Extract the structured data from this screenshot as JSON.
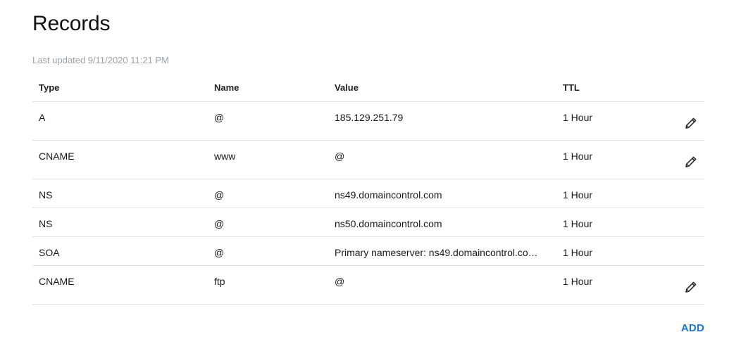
{
  "page": {
    "title": "Records",
    "last_updated": "Last updated 9/11/2020 11:21 PM"
  },
  "table": {
    "headers": {
      "type": "Type",
      "name": "Name",
      "value": "Value",
      "ttl": "TTL"
    },
    "rows": [
      {
        "type": "A",
        "name": "@",
        "value": "185.129.251.79",
        "ttl": "1 Hour",
        "editable": true
      },
      {
        "type": "CNAME",
        "name": "www",
        "value": "@",
        "ttl": "1 Hour",
        "editable": true
      },
      {
        "type": "NS",
        "name": "@",
        "value": "ns49.domaincontrol.com",
        "ttl": "1 Hour",
        "editable": false
      },
      {
        "type": "NS",
        "name": "@",
        "value": "ns50.domaincontrol.com",
        "ttl": "1 Hour",
        "editable": false
      },
      {
        "type": "SOA",
        "name": "@",
        "value": "Primary nameserver: ns49.domaincontrol.co…",
        "ttl": "1 Hour",
        "editable": false
      },
      {
        "type": "CNAME",
        "name": "ftp",
        "value": "@",
        "ttl": "1 Hour",
        "editable": true
      }
    ]
  },
  "actions": {
    "add_label": "ADD",
    "edit_icon": "pencil-icon"
  },
  "colors": {
    "accent": "#1976d2",
    "muted_text": "#9aa3a9",
    "divider": "#e2e2e2"
  }
}
